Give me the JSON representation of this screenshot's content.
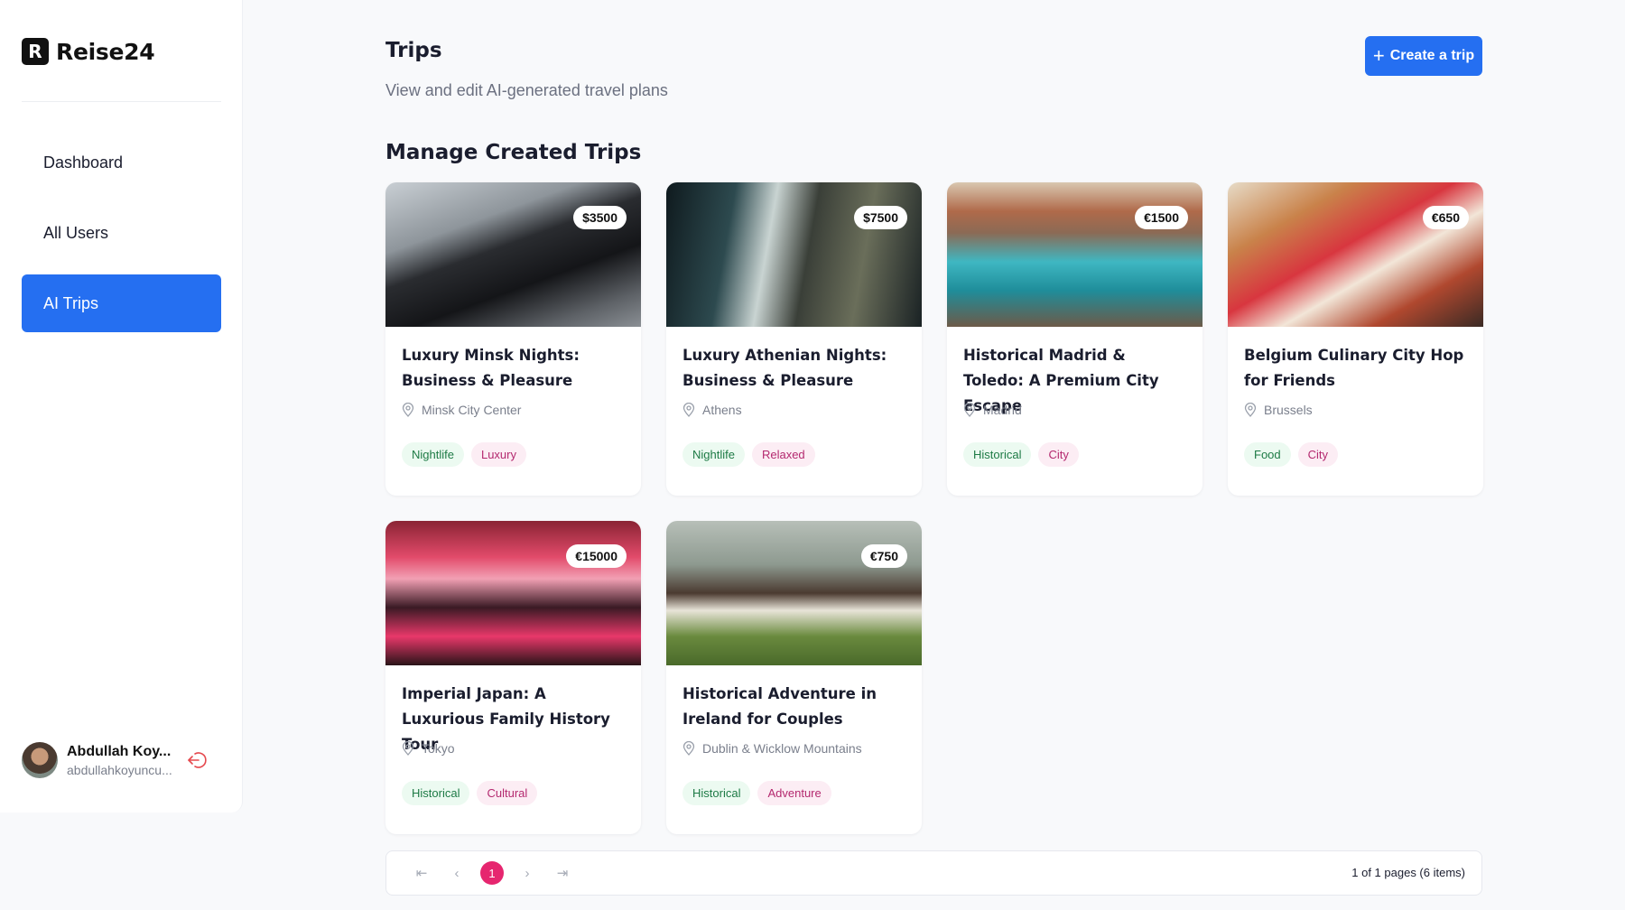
{
  "brand": {
    "mark": "R",
    "name": "Reise24"
  },
  "nav": {
    "dashboard": "Dashboard",
    "all_users": "All Users",
    "ai_trips": "AI Trips"
  },
  "user": {
    "name": "Abdullah Koy...",
    "email": "abdullahkoyuncu..."
  },
  "header": {
    "title": "Trips",
    "subtitle": "View and edit AI-generated travel plans",
    "create_label": "Create a trip",
    "section_title": "Manage Created Trips"
  },
  "trips": [
    {
      "price": "$3500",
      "title": "Luxury Minsk Nights: Business & Pleasure",
      "location": "Minsk City Center",
      "tags": [
        "Nightlife",
        "Luxury"
      ]
    },
    {
      "price": "$7500",
      "title": "Luxury Athenian Nights: Business & Pleasure",
      "location": "Athens",
      "tags": [
        "Nightlife",
        "Relaxed"
      ]
    },
    {
      "price": "€1500",
      "title": "Historical Madrid & Toledo: A Premium City Escape",
      "location": "Madrid",
      "tags": [
        "Historical",
        "City"
      ]
    },
    {
      "price": "€650",
      "title": "Belgium Culinary City Hop for Friends",
      "location": "Brussels",
      "tags": [
        "Food",
        "City"
      ]
    },
    {
      "price": "€15000",
      "title": "Imperial Japan: A Luxurious Family History Tour",
      "location": "Tokyo",
      "tags": [
        "Historical",
        "Cultural"
      ]
    },
    {
      "price": "€750",
      "title": "Historical Adventure in Ireland for Couples",
      "location": "Dublin & Wicklow Mountains",
      "tags": [
        "Historical",
        "Adventure"
      ]
    }
  ],
  "pagination": {
    "first": "⇤",
    "prev": "‹",
    "current": "1",
    "next": "›",
    "last": "⇥",
    "status": "1 of 1 pages (6 items)"
  },
  "colors": {
    "accent": "#256ff1",
    "page_active": "#e6266f",
    "tag_green": "#1d7a45",
    "tag_pink": "#b4296f"
  }
}
